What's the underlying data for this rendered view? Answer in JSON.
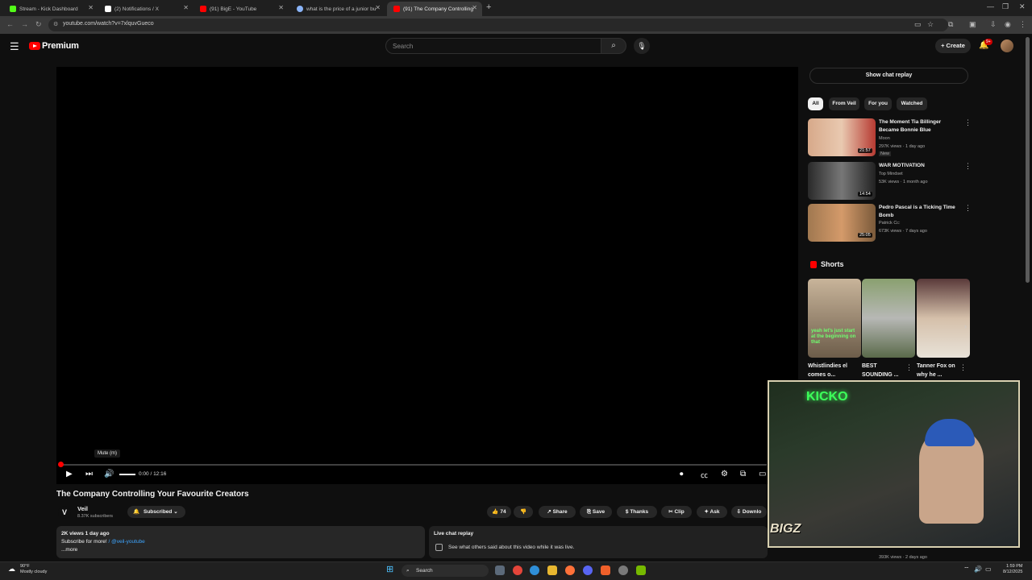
{
  "browser": {
    "tabs": [
      {
        "title": "Stream - Kick Dashboard",
        "color": "#53fc18"
      },
      {
        "title": "(2) Notifications / X",
        "color": "#ffffff"
      },
      {
        "title": "(91) BigE - YouTube",
        "color": "#ff0000"
      },
      {
        "title": "what is the price of a junior bu",
        "color": "#8ab4f8"
      },
      {
        "title": "(91) The Company Controlling",
        "color": "#ff0000"
      }
    ],
    "url": "youtube.com/watch?v=7xlquvGueco",
    "new_tab": "+"
  },
  "youtube": {
    "brand": "Premium",
    "search_placeholder": "Search",
    "create_label": "Create",
    "notif_badge": "9+"
  },
  "player": {
    "tooltip": "Mute (m)",
    "time": "0:00 / 12:16",
    "progress_fraction": 0.0
  },
  "video": {
    "title": "The Company Controlling Your Favourite Creators",
    "channel_initial": "V",
    "channel_name": "Veil",
    "subscribers": "8.37K subscribers",
    "subscribed_label": "Subscribed",
    "likes": "74",
    "share_label": "Share",
    "save_label": "Save",
    "thanks_label": "Thanks",
    "clip_label": "Clip",
    "ask_label": "Ask",
    "download_label": "Downlo",
    "views": "2K views  1 day ago",
    "desc_line": "Subscribe for more!  ",
    "desc_handle": "/ @veil-youtube",
    "more": "...more",
    "chat_title": "Live chat replay",
    "chat_sub": "See what others said about this video while it was live."
  },
  "sidebar": {
    "show_chat": "Show chat replay",
    "chips": [
      "All",
      "From Veil",
      "For you",
      "Watched"
    ],
    "videos": [
      {
        "title": "The Moment Tia Billinger Became Bonnie Blue",
        "channel": "Moon",
        "meta": "297K views · 1 day ago",
        "badge": "New",
        "duration": "21:57"
      },
      {
        "title": "WAR MOTIVATION",
        "channel": "Top Mindset",
        "meta": "53K views · 1 month ago",
        "badge": "",
        "duration": "14:54"
      },
      {
        "title": "Pedro Pascal is a Ticking Time Bomb",
        "channel": "Patrick Cc:",
        "meta": "673K views · 7 days ago",
        "badge": "",
        "duration": "25:05"
      }
    ],
    "shorts_label": "Shorts",
    "shorts": [
      {
        "title": "Whistlindies el comes o...",
        "caption": "yeah let's just start at the beginning on that"
      },
      {
        "title": "BEST SOUNDING ...",
        "caption": ""
      },
      {
        "title": "Tanner Fox on why he ...",
        "caption": ""
      }
    ],
    "bottom_meta": "393K views · 2 days ago"
  },
  "overlay": {
    "neon_text": "KICKO",
    "logo_text": "BIGZ"
  },
  "taskbar": {
    "temp": "90°F",
    "weather": "Mostly cloudy",
    "search": "Search",
    "time": "1:59 PM",
    "date": "8/12/2025"
  }
}
